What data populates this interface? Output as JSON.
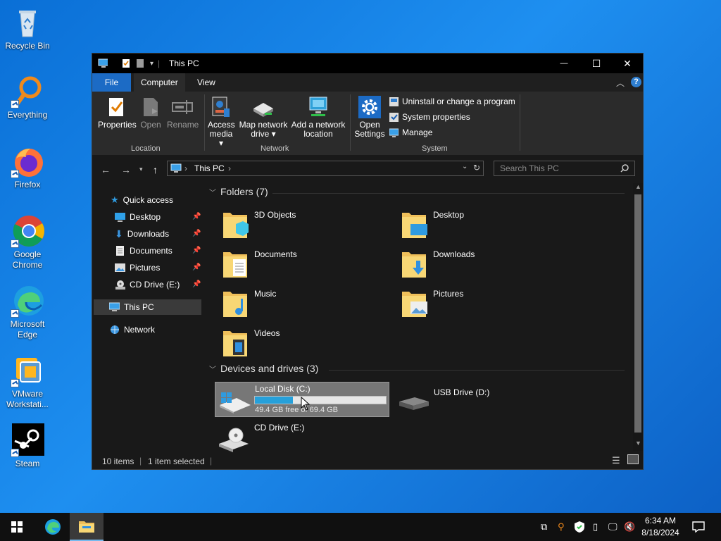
{
  "desktop": {
    "icons": [
      {
        "label": "Recycle Bin",
        "icon": "recycle-bin-icon"
      },
      {
        "label": "Everything",
        "icon": "everything-search-icon"
      },
      {
        "label": "Firefox",
        "icon": "firefox-icon"
      },
      {
        "label": "Google Chrome",
        "icon": "chrome-icon"
      },
      {
        "label": "Microsoft Edge",
        "icon": "edge-icon"
      },
      {
        "label": "VMware Workstati...",
        "icon": "vmware-icon"
      },
      {
        "label": "Steam",
        "icon": "steam-icon"
      }
    ]
  },
  "window": {
    "title": "This PC",
    "controls": {
      "minimize": "—",
      "maximize": "☐",
      "close": "✕"
    },
    "tabs": {
      "file": "File",
      "computer": "Computer",
      "view": "View"
    },
    "ribbon": {
      "location": {
        "group": "Location",
        "properties": "Properties",
        "open": "Open",
        "rename": "Rename"
      },
      "network": {
        "group": "Network",
        "access_media_1": "Access",
        "access_media_2": "media ▾",
        "map_drive_1": "Map network",
        "map_drive_2": "drive ▾",
        "add_location_1": "Add a network",
        "add_location_2": "location"
      },
      "system": {
        "group": "System",
        "open_settings_1": "Open",
        "open_settings_2": "Settings",
        "uninstall": "Uninstall or change a program",
        "system_properties": "System properties",
        "manage": "Manage"
      }
    },
    "address": {
      "crumb": "This PC",
      "search_placeholder": "Search This PC"
    },
    "nav": {
      "quick_access": "Quick access",
      "items": [
        "Desktop",
        "Downloads",
        "Documents",
        "Pictures",
        "CD Drive (E:)"
      ],
      "this_pc": "This PC",
      "network": "Network"
    },
    "folders": {
      "header": "Folders (7)",
      "items": [
        "3D Objects",
        "Desktop",
        "Documents",
        "Downloads",
        "Music",
        "Pictures",
        "Videos"
      ]
    },
    "drives": {
      "header": "Devices and drives (3)",
      "local": {
        "name": "Local Disk (C:)",
        "free": "49.4 GB free of 69.4 GB",
        "used_fraction": 0.29
      },
      "usb": {
        "name": "USB Drive (D:)"
      },
      "cd": {
        "name": "CD Drive (E:)"
      }
    },
    "status": {
      "items": "10 items",
      "selected": "1 item selected"
    }
  },
  "taskbar": {
    "time": "6:34 AM",
    "date": "8/18/2024"
  },
  "colors": {
    "accent": "#1c6bc5",
    "window_bg": "#191919",
    "ribbon_bg": "#2b2b2b",
    "selection": "#777777"
  }
}
